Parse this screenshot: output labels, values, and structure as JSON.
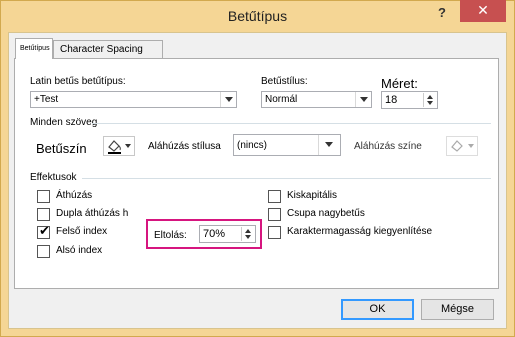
{
  "window": {
    "title": "Betűtípus",
    "help": "?",
    "close": "✕"
  },
  "tabs": [
    {
      "label": "Betűtípus"
    },
    {
      "label": "Character Spacing"
    }
  ],
  "font": {
    "latin_label": "Latin betűs betűtípus:",
    "latin_value": "+Test",
    "style_label": "Betűstílus:",
    "style_value": "Normál",
    "size_label": "Méret:",
    "size_value": "18"
  },
  "all_text": {
    "group_label": "Minden szöveg",
    "font_color_label": "Betűszín",
    "underline_style_label": "Aláhúzás stílusa",
    "underline_style_value": "(nincs)",
    "underline_color_label": "Aláhúzás színe"
  },
  "effects": {
    "group_label": "Effektusok",
    "left": [
      {
        "label": "Áthúzás",
        "checked": false
      },
      {
        "label": "Dupla áthúzás h",
        "checked": false
      },
      {
        "label": "Felső index",
        "checked": true
      },
      {
        "label": "Alsó index",
        "checked": false
      }
    ],
    "right": [
      {
        "label": "Kiskapitális",
        "checked": false
      },
      {
        "label": "Csupa nagybetűs",
        "checked": false
      },
      {
        "label": "Karaktermagasság kiegyenlítése",
        "checked": false
      }
    ],
    "offset_label": "Eltolás:",
    "offset_value": "70%"
  },
  "buttons": {
    "ok": "OK",
    "cancel": "Mégse"
  },
  "colors": {
    "title_bar": "#f5d695",
    "close": "#c75050",
    "highlight": "#d6157f"
  }
}
